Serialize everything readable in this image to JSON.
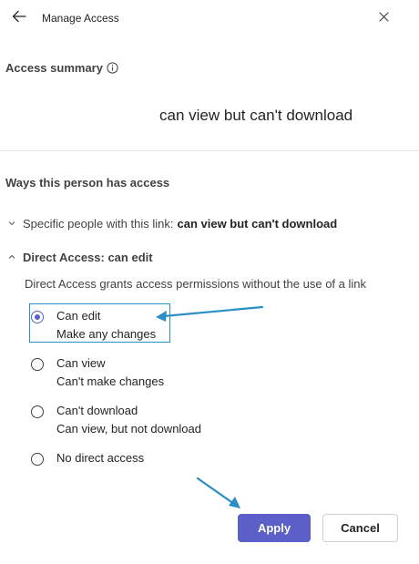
{
  "header": {
    "title": "Manage Access",
    "back_icon": "arrow-left-icon",
    "close_icon": "close-icon"
  },
  "summary": {
    "title": "Access summary",
    "info_icon": "info-icon",
    "text": "can view but can't download"
  },
  "ways": {
    "title": "Ways this person has access",
    "specific_link": {
      "label": "Specific people with this link:",
      "value": "can view but can't download",
      "expanded": false
    },
    "direct_access": {
      "label": "Direct Access: can edit",
      "expanded": true,
      "description": "Direct Access grants access permissions without the use of a link",
      "options": [
        {
          "title": "Can edit",
          "subtitle": "Make any changes",
          "selected": true
        },
        {
          "title": "Can view",
          "subtitle": "Can't make changes",
          "selected": false
        },
        {
          "title": "Can't download",
          "subtitle": "Can view, but not download",
          "selected": false
        },
        {
          "title": "No direct access",
          "subtitle": "",
          "selected": false
        }
      ]
    }
  },
  "buttons": {
    "apply": "Apply",
    "cancel": "Cancel"
  },
  "colors": {
    "accent": "#5b5fc7",
    "annotation": "#2b8fc6"
  }
}
